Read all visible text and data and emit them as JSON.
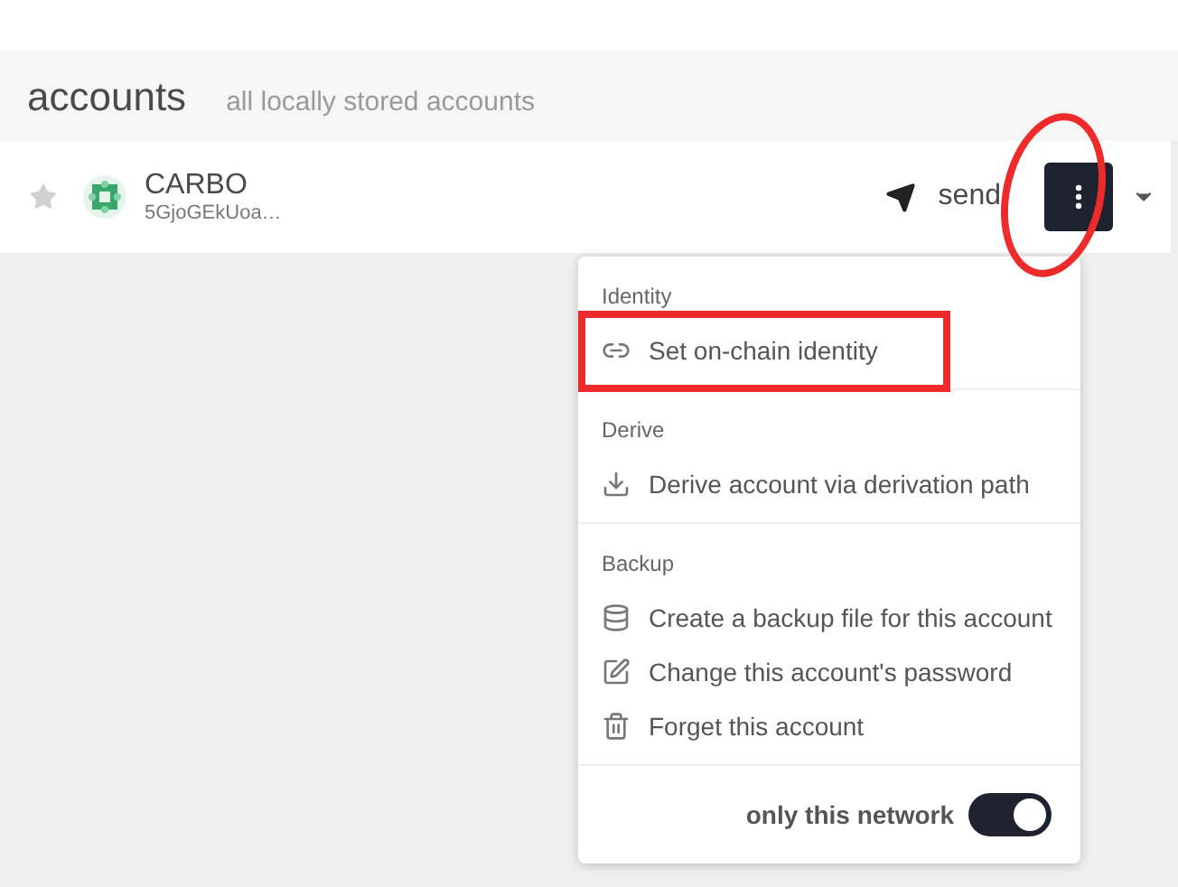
{
  "header": {
    "title": "accounts",
    "subtitle": "all locally stored accounts"
  },
  "account": {
    "favorite": false,
    "name": "CARBO",
    "address": "5GjoGEkUoa…",
    "send_label": "send"
  },
  "menu": {
    "sections": [
      {
        "title": "Identity",
        "items": [
          {
            "label": "Set on-chain identity",
            "kind": "link"
          }
        ]
      },
      {
        "title": "Derive",
        "items": [
          {
            "label": "Derive account via derivation path",
            "kind": "download"
          }
        ]
      },
      {
        "title": "Backup",
        "items": [
          {
            "label": "Create a backup file for this account",
            "kind": "database"
          },
          {
            "label": "Change this account's password",
            "kind": "edit"
          },
          {
            "label": "Forget this account",
            "kind": "trash"
          }
        ]
      }
    ],
    "toggle": {
      "label": "only this network",
      "on": true
    }
  }
}
